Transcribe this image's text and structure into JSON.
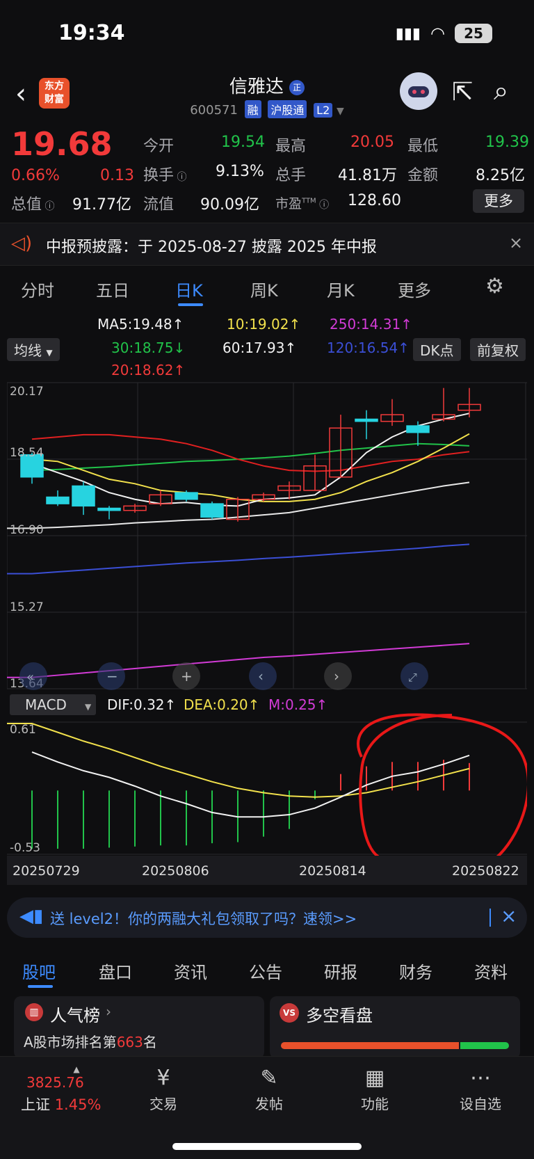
{
  "status": {
    "time": "19:34",
    "battery": "25"
  },
  "header": {
    "logo_line1": "东方",
    "logo_line2": "财富",
    "name": "信雅达",
    "name_badge": "正",
    "code": "600571",
    "tags": [
      "融",
      "沪股通",
      "L2"
    ]
  },
  "quote": {
    "price": "19.68",
    "change_pct": "0.66%",
    "change": "0.13",
    "open_label": "今开",
    "open": "19.54",
    "high_label": "最高",
    "high": "20.05",
    "low_label": "最低",
    "low": "19.39",
    "turnover_label": "换手",
    "turnover": "9.13%",
    "volume_label": "总手",
    "volume": "41.81万",
    "amount_label": "金额",
    "amount": "8.25亿",
    "mcap_label": "总值",
    "mcap": "91.77亿",
    "float_label": "流值",
    "float_cap": "90.09亿",
    "pe_label": "市盈",
    "pe_sup": "TTM",
    "pe": "128.60",
    "more": "更多"
  },
  "notice": {
    "text": "中报预披露：于 2025-08-27 披露 2025 年中报"
  },
  "period_tabs": [
    "分时",
    "五日",
    "日K",
    "周K",
    "月K",
    "更多"
  ],
  "ma": {
    "selector": "均线",
    "ma5": "MA5:19.48↑",
    "ma10": "10:19.02↑",
    "ma250": "250:14.31↑",
    "ma30": "30:18.75↓",
    "ma60": "60:17.93↑",
    "ma120": "120:16.54↑",
    "ma20": "20:18.62↑",
    "dk_btn": "DK点",
    "adjust_btn": "前复权"
  },
  "chart": {
    "y_labels": [
      "20.17",
      "18.54",
      "16.90",
      "15.27",
      "13.64"
    ],
    "macd_selector": "MACD",
    "dif": "DIF:0.32↑",
    "dea": "DEA:0.20↑",
    "m": "M:0.25↑",
    "macd_top": "0.61",
    "macd_bottom": "-0.53",
    "dates": [
      "20250729",
      "20250806",
      "20250814",
      "20250822"
    ]
  },
  "chart_data": {
    "type": "candlestick",
    "candles": [
      {
        "o": 18.55,
        "c": 18.05,
        "h": 18.6,
        "l": 17.9
      },
      {
        "o": 17.6,
        "c": 17.45,
        "h": 17.75,
        "l": 17.4
      },
      {
        "o": 17.85,
        "c": 17.4,
        "h": 17.95,
        "l": 17.2
      },
      {
        "o": 17.35,
        "c": 17.3,
        "h": 17.4,
        "l": 17.1
      },
      {
        "o": 17.3,
        "c": 17.4,
        "h": 17.45,
        "l": 17.25
      },
      {
        "o": 17.45,
        "c": 17.65,
        "h": 17.75,
        "l": 17.4
      },
      {
        "o": 17.7,
        "c": 17.55,
        "h": 17.75,
        "l": 17.5
      },
      {
        "o": 17.45,
        "c": 17.15,
        "h": 17.5,
        "l": 17.1
      },
      {
        "o": 17.1,
        "c": 17.55,
        "h": 17.6,
        "l": 17.05
      },
      {
        "o": 17.55,
        "c": 17.65,
        "h": 17.7,
        "l": 17.5
      },
      {
        "o": 17.75,
        "c": 17.85,
        "h": 17.95,
        "l": 17.55
      },
      {
        "o": 17.75,
        "c": 18.3,
        "h": 18.55,
        "l": 17.75
      },
      {
        "o": 18.05,
        "c": 19.15,
        "h": 19.45,
        "l": 18.05
      },
      {
        "o": 19.35,
        "c": 19.3,
        "h": 19.55,
        "l": 18.9
      },
      {
        "o": 19.3,
        "c": 19.45,
        "h": 19.8,
        "l": 19.2
      },
      {
        "o": 19.2,
        "c": 19.05,
        "h": 19.3,
        "l": 18.75
      },
      {
        "o": 19.35,
        "c": 19.45,
        "h": 20.05,
        "l": 19.3
      },
      {
        "o": 19.55,
        "c": 19.68,
        "h": 20.05,
        "l": 19.39
      }
    ],
    "ma5": [
      18.35,
      18.15,
      17.95,
      17.7,
      17.55,
      17.45,
      17.48,
      17.42,
      17.4,
      17.55,
      17.58,
      17.65,
      18.05,
      18.6,
      18.95,
      19.2,
      19.35,
      19.48
    ],
    "ma10": [
      18.45,
      18.4,
      18.2,
      18.0,
      17.9,
      17.75,
      17.7,
      17.65,
      17.55,
      17.5,
      17.5,
      17.55,
      17.7,
      17.95,
      18.15,
      18.4,
      18.7,
      19.02
    ],
    "ma20": [
      18.9,
      18.95,
      19.0,
      19.0,
      18.95,
      18.9,
      18.8,
      18.65,
      18.45,
      18.3,
      18.2,
      18.18,
      18.2,
      18.3,
      18.4,
      18.45,
      18.55,
      18.62
    ],
    "ma30": [
      18.2,
      18.22,
      18.25,
      18.28,
      18.32,
      18.36,
      18.4,
      18.42,
      18.45,
      18.48,
      18.52,
      18.58,
      18.65,
      18.7,
      18.75,
      18.8,
      18.78,
      18.75
    ],
    "ma60": [
      16.9,
      16.92,
      16.95,
      16.98,
      17.02,
      17.05,
      17.08,
      17.1,
      17.15,
      17.2,
      17.25,
      17.35,
      17.45,
      17.55,
      17.65,
      17.75,
      17.85,
      17.93
    ],
    "ma120": [
      15.88,
      15.92,
      15.96,
      16.0,
      16.04,
      16.08,
      16.12,
      16.15,
      16.18,
      16.22,
      16.25,
      16.29,
      16.33,
      16.37,
      16.41,
      16.45,
      16.5,
      16.54
    ],
    "ma250": [
      13.55,
      13.6,
      13.65,
      13.7,
      13.75,
      13.8,
      13.85,
      13.9,
      13.95,
      14.0,
      14.03,
      14.07,
      14.11,
      14.15,
      14.19,
      14.23,
      14.27,
      14.31
    ],
    "dif": [
      0.35,
      0.26,
      0.18,
      0.12,
      0.04,
      -0.05,
      -0.12,
      -0.2,
      -0.24,
      -0.24,
      -0.22,
      -0.16,
      -0.06,
      0.05,
      0.13,
      0.17,
      0.24,
      0.32
    ],
    "dea": [
      0.61,
      0.53,
      0.45,
      0.38,
      0.3,
      0.22,
      0.15,
      0.08,
      0.02,
      -0.02,
      -0.05,
      -0.06,
      -0.05,
      -0.02,
      0.03,
      0.08,
      0.14,
      0.2
    ],
    "macd": [
      -0.53,
      -0.53,
      -0.53,
      -0.52,
      -0.51,
      -0.5,
      -0.5,
      -0.48,
      -0.47,
      -0.42,
      -0.35,
      -0.08,
      0.15,
      0.22,
      0.26,
      0.26,
      0.28,
      0.25
    ],
    "ylim_main": [
      13.64,
      20.17
    ],
    "ylim_macd": [
      -0.53,
      0.61
    ]
  },
  "promo": {
    "text": "送 level2！你的两融大礼包领取了吗？速领>>"
  },
  "bottom_tabs": [
    "股吧",
    "盘口",
    "资讯",
    "公告",
    "研报",
    "财务",
    "资料"
  ],
  "cards": {
    "left_title": "人气榜",
    "left_sub_pre": "A股市场排名第",
    "left_rank": "663",
    "left_sub_post": "名",
    "right_title": "多空看盘"
  },
  "index": {
    "value": "3825.76",
    "name": "上证",
    "pct": "1.45%"
  },
  "tabbar": [
    "交易",
    "发帖",
    "功能",
    "设自选"
  ],
  "colors": {
    "up": "#f23a3a",
    "down": "#21c34a",
    "accent": "#3d8bff"
  }
}
